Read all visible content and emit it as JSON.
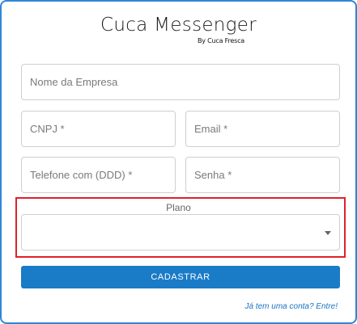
{
  "brand": {
    "title": "Cuca Messenger",
    "byline": "By Cuca Fresca"
  },
  "form": {
    "company_name": {
      "placeholder": "Nome da Empresa",
      "value": ""
    },
    "cnpj": {
      "placeholder": "CNPJ *",
      "value": ""
    },
    "email": {
      "placeholder": "Email *",
      "value": ""
    },
    "phone": {
      "placeholder": "Telefone com (DDD) *",
      "value": ""
    },
    "password": {
      "placeholder": "Senha *",
      "value": ""
    },
    "plan": {
      "label": "Plano",
      "selected": ""
    }
  },
  "actions": {
    "submit_label": "CADASTRAR",
    "login_link": "Já tem uma conta? Entre!"
  },
  "colors": {
    "primary": "#1a7bc7",
    "frame_border": "#2f86d4",
    "highlight": "#e0212b",
    "link": "#1a73c4"
  }
}
